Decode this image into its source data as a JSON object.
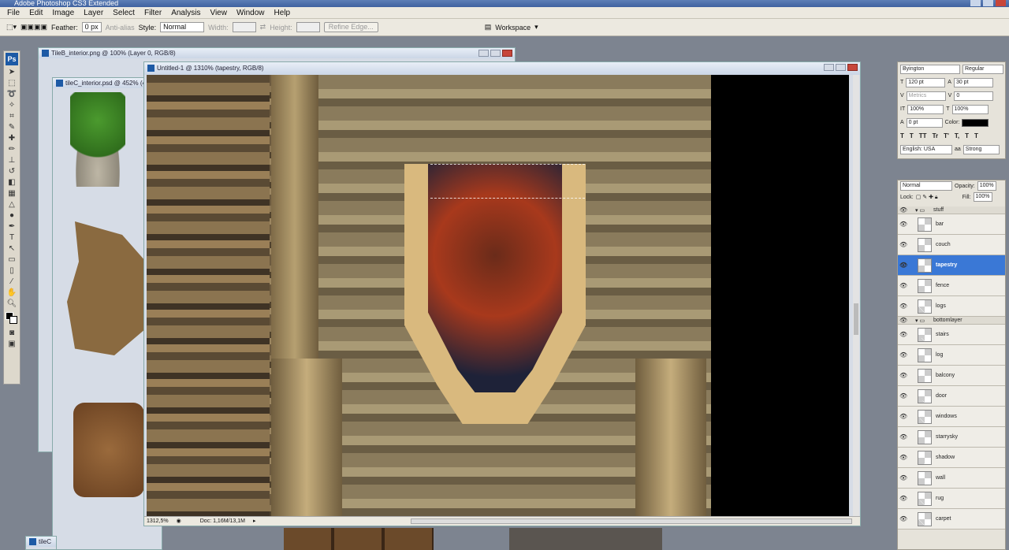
{
  "app": {
    "title": "Adobe Photoshop CS3 Extended"
  },
  "menu": [
    "File",
    "Edit",
    "Image",
    "Layer",
    "Select",
    "Filter",
    "Analysis",
    "View",
    "Window",
    "Help"
  ],
  "options": {
    "feather_label": "Feather:",
    "feather_value": "0 px",
    "antialias_label": "Anti-alias",
    "style_label": "Style:",
    "style_value": "Normal",
    "width_label": "Width:",
    "height_label": "Height:",
    "refine_edge": "Refine Edge...",
    "workspace": "Workspace"
  },
  "toolbox": {
    "logo": "Ps"
  },
  "documents": {
    "back1_title": "TileB_interior.png @ 100% (Layer 0, RGB/8)",
    "back2_title": "tileC_interior.psd @ 452% (4",
    "back3_title": "tileC",
    "main_title": "Untitled-1 @ 1310% (tapestry, RGB/8)",
    "zoom": "1312,5%",
    "doc_info": "Doc: 1,16M/13,1M"
  },
  "character_panel": {
    "font_family": "Byington",
    "font_style": "Regular",
    "font_size": "120 pt",
    "leading": "30 pt",
    "kerning": "Metrics",
    "tracking": "0",
    "vscale": "100%",
    "hscale": "100%",
    "baseline": "0 pt",
    "color_label": "Color:",
    "language": "English: USA",
    "antialias": "Strong",
    "aa_label": "aa"
  },
  "layers_panel": {
    "blend_mode": "Normal",
    "opacity_label": "Opacity:",
    "opacity": "100%",
    "lock_label": "Lock:",
    "fill_label": "Fill:",
    "fill": "100%",
    "layers": [
      {
        "name": "stuff",
        "group": true
      },
      {
        "name": "bar"
      },
      {
        "name": "couch"
      },
      {
        "name": "tapestry",
        "selected": true
      },
      {
        "name": "fence"
      },
      {
        "name": "logs"
      },
      {
        "name": "bottomlayer",
        "group": true
      },
      {
        "name": "stairs"
      },
      {
        "name": "log"
      },
      {
        "name": "balcony"
      },
      {
        "name": "door"
      },
      {
        "name": "windows"
      },
      {
        "name": "starrysky"
      },
      {
        "name": "shadow"
      },
      {
        "name": "wall"
      },
      {
        "name": "rug"
      },
      {
        "name": "carpet"
      }
    ]
  },
  "colors": {
    "selected_layer": "#3a78d6",
    "ps_blue": "#1d5aa5"
  }
}
